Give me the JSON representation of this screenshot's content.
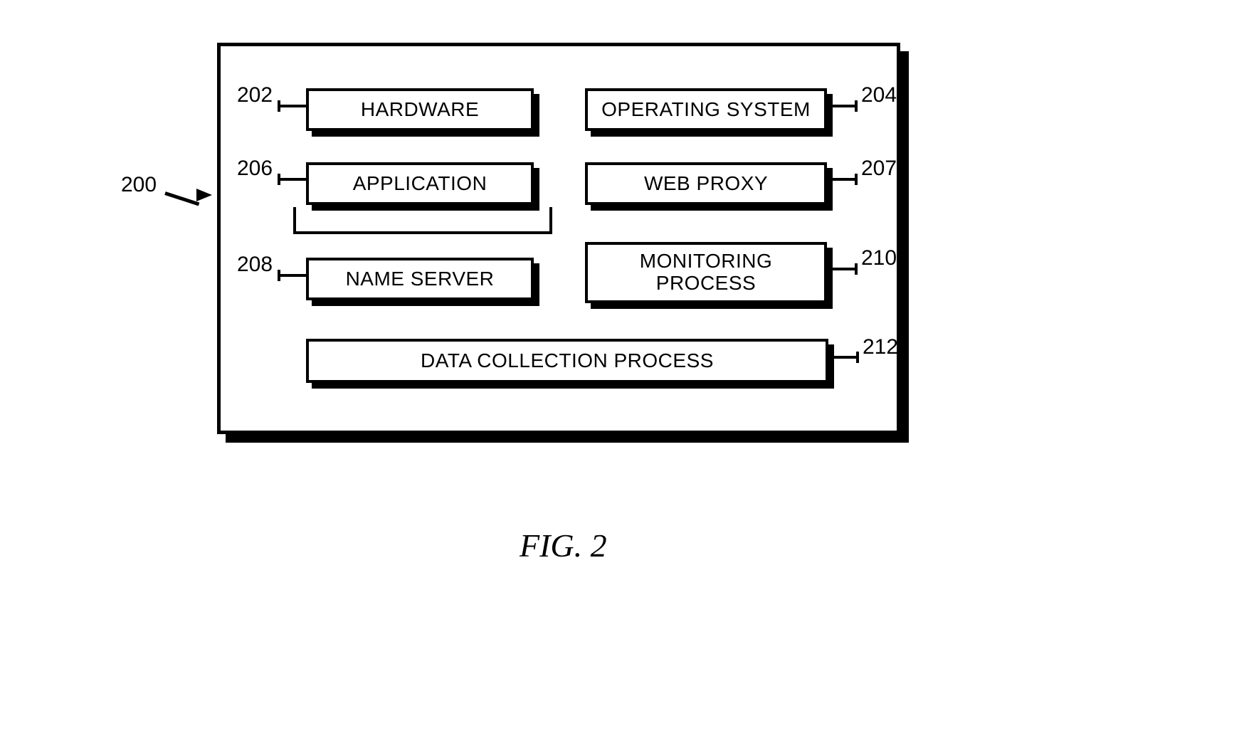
{
  "figure_ref": "200",
  "caption": "FIG. 2",
  "boxes": {
    "hardware": {
      "label": "HARDWARE",
      "ref": "202"
    },
    "os": {
      "label": "OPERATING SYSTEM",
      "ref": "204"
    },
    "application": {
      "label": "APPLICATION",
      "ref": "206"
    },
    "webproxy": {
      "label": "WEB PROXY",
      "ref": "207"
    },
    "nameserver": {
      "label": "NAME SERVER",
      "ref": "208"
    },
    "monitoring": {
      "label": "MONITORING\nPROCESS",
      "ref": "210"
    },
    "datacollection": {
      "label": "DATA COLLECTION PROCESS",
      "ref": "212"
    }
  }
}
